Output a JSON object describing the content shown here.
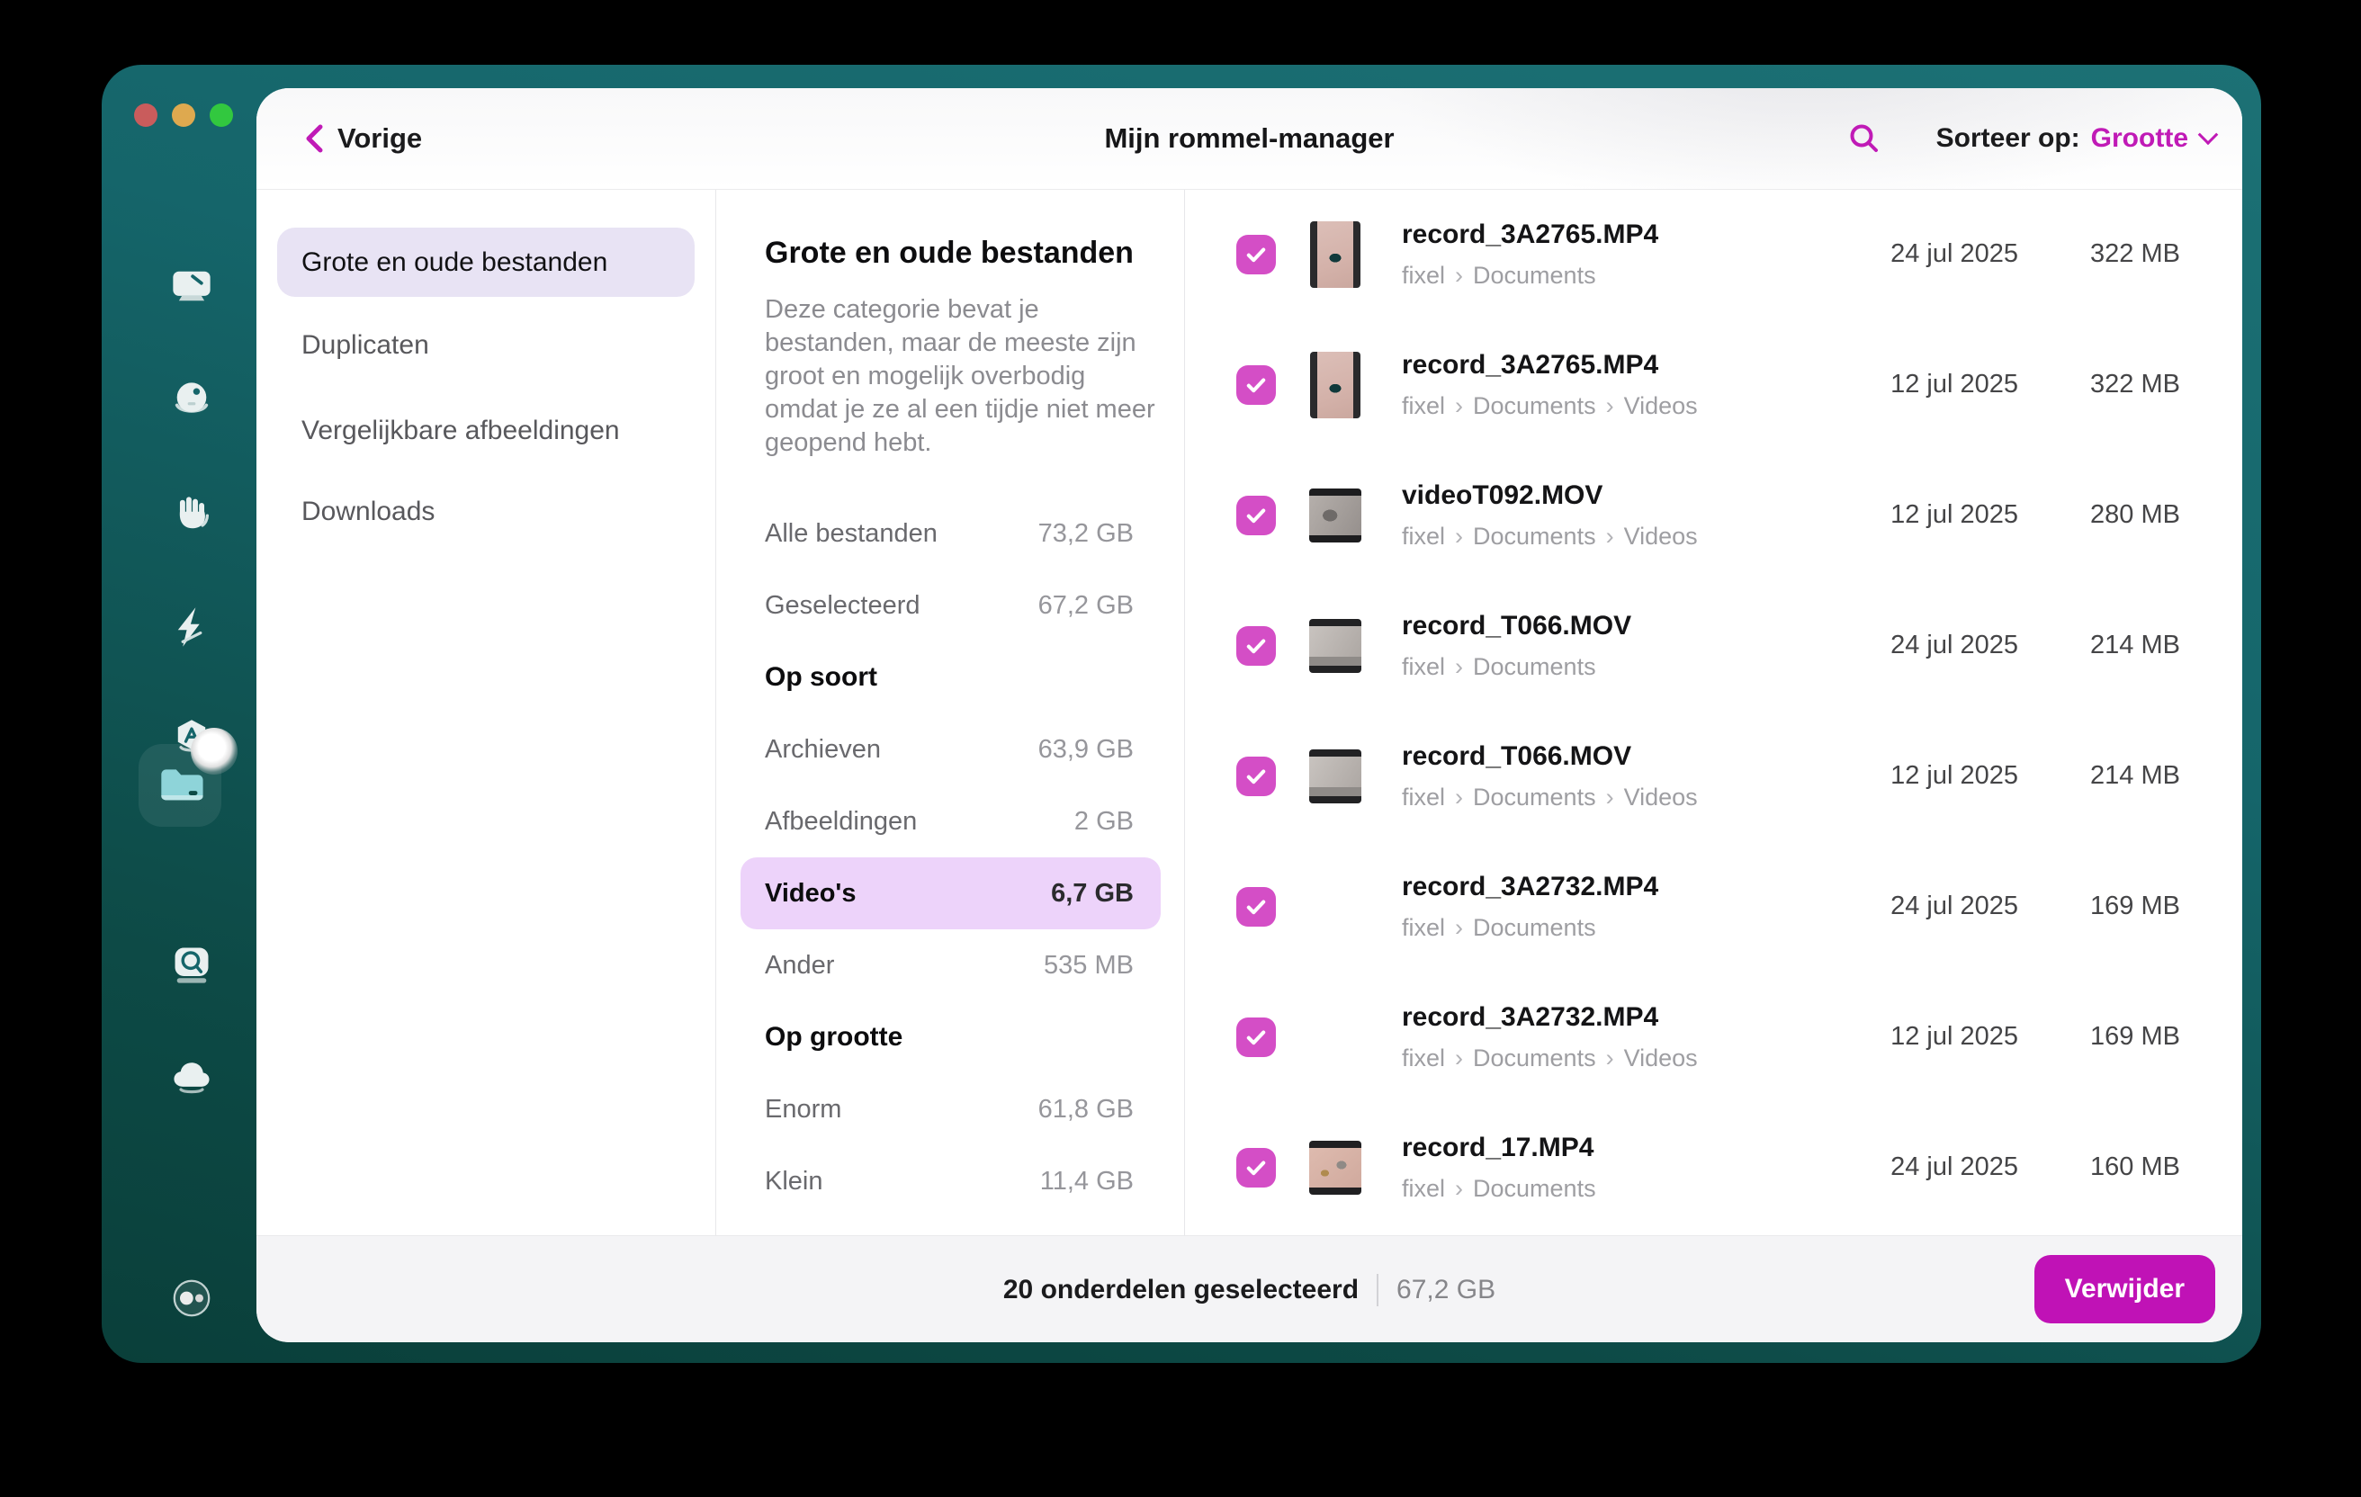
{
  "colors": {
    "accent_magenta": "#c01ab6",
    "checkbox_magenta": "#d44ec6",
    "delete_button": "#c012b6",
    "window_teal": "#15656a",
    "nav_selected_bg": "#e8e3f4",
    "stat_selected_bg": "#edd3fa"
  },
  "header": {
    "back_label": "Vorige",
    "title": "Mijn rommel-manager",
    "search_icon": "search-icon",
    "sort_label": "Sorteer op:",
    "sort_value": "Grootte"
  },
  "sidebar": {
    "icons": [
      "cleanup-desk-icon",
      "smart-ball-icon",
      "protection-hand-icon",
      "performance-lightning-icon",
      "applications-badge-icon",
      "clutter-folder-icon-active",
      "storage-lens-icon",
      "cloud-icon",
      "assistant-dots-icon"
    ]
  },
  "nav": {
    "items": [
      {
        "label": "Grote en oude bestanden",
        "selected": true
      },
      {
        "label": "Duplicaten",
        "selected": false
      },
      {
        "label": "Vergelijkbare afbeeldingen",
        "selected": false
      },
      {
        "label": "Downloads",
        "selected": false
      }
    ]
  },
  "detail": {
    "title": "Grote en oude bestanden",
    "description": "Deze categorie bevat je bestanden, maar de meeste zijn groot en mogelijk overbodig omdat je ze al een tijdje niet meer geopend hebt.",
    "stats": [
      {
        "type": "stat",
        "label": "Alle bestanden",
        "value": "73,2 GB"
      },
      {
        "type": "stat",
        "label": "Geselecteerd",
        "value": "67,2 GB"
      },
      {
        "type": "section",
        "label": "Op soort",
        "value": ""
      },
      {
        "type": "stat",
        "label": "Archieven",
        "value": "63,9 GB"
      },
      {
        "type": "stat",
        "label": "Afbeeldingen",
        "value": "2 GB"
      },
      {
        "type": "stat",
        "label": "Video's",
        "value": "6,7 GB",
        "selected": true
      },
      {
        "type": "stat",
        "label": "Ander",
        "value": "535 MB"
      },
      {
        "type": "section",
        "label": "Op grootte",
        "value": ""
      },
      {
        "type": "stat",
        "label": "Enorm",
        "value": "61,8 GB"
      },
      {
        "type": "stat",
        "label": "Klein",
        "value": "11,4 GB"
      }
    ]
  },
  "files": [
    {
      "name": "record_3A2765.MP4",
      "path": [
        "fixel",
        "Documents"
      ],
      "date": "24 jul 2025",
      "size": "322 MB",
      "checked": true,
      "thumb": "laptop-portrait"
    },
    {
      "name": "record_3A2765.MP4",
      "path": [
        "fixel",
        "Documents",
        "Videos"
      ],
      "date": "12 jul 2025",
      "size": "322 MB",
      "checked": true,
      "thumb": "laptop-portrait"
    },
    {
      "name": "videoT092.MOV",
      "path": [
        "fixel",
        "Documents",
        "Videos"
      ],
      "date": "12 jul 2025",
      "size": "280 MB",
      "checked": true,
      "thumb": "gray-video"
    },
    {
      "name": "record_T066.MOV",
      "path": [
        "fixel",
        "Documents"
      ],
      "date": "24 jul 2025",
      "size": "214 MB",
      "checked": true,
      "thumb": "gray-desk"
    },
    {
      "name": "record_T066.MOV",
      "path": [
        "fixel",
        "Documents",
        "Videos"
      ],
      "date": "12 jul 2025",
      "size": "214 MB",
      "checked": true,
      "thumb": "gray-desk"
    },
    {
      "name": "record_3A2732.MP4",
      "path": [
        "fixel",
        "Documents"
      ],
      "date": "24 jul 2025",
      "size": "169 MB",
      "checked": true,
      "thumb": "pink-tv"
    },
    {
      "name": "record_3A2732.MP4",
      "path": [
        "fixel",
        "Documents",
        "Videos"
      ],
      "date": "12 jul 2025",
      "size": "169 MB",
      "checked": true,
      "thumb": "pink-tv"
    },
    {
      "name": "record_17.MP4",
      "path": [
        "fixel",
        "Documents"
      ],
      "date": "24 jul 2025",
      "size": "160 MB",
      "checked": true,
      "thumb": "pink-room"
    }
  ],
  "footer": {
    "selected_count": "20 onderdelen geselecteerd",
    "selected_size": "67,2 GB",
    "delete_label": "Verwijder"
  }
}
